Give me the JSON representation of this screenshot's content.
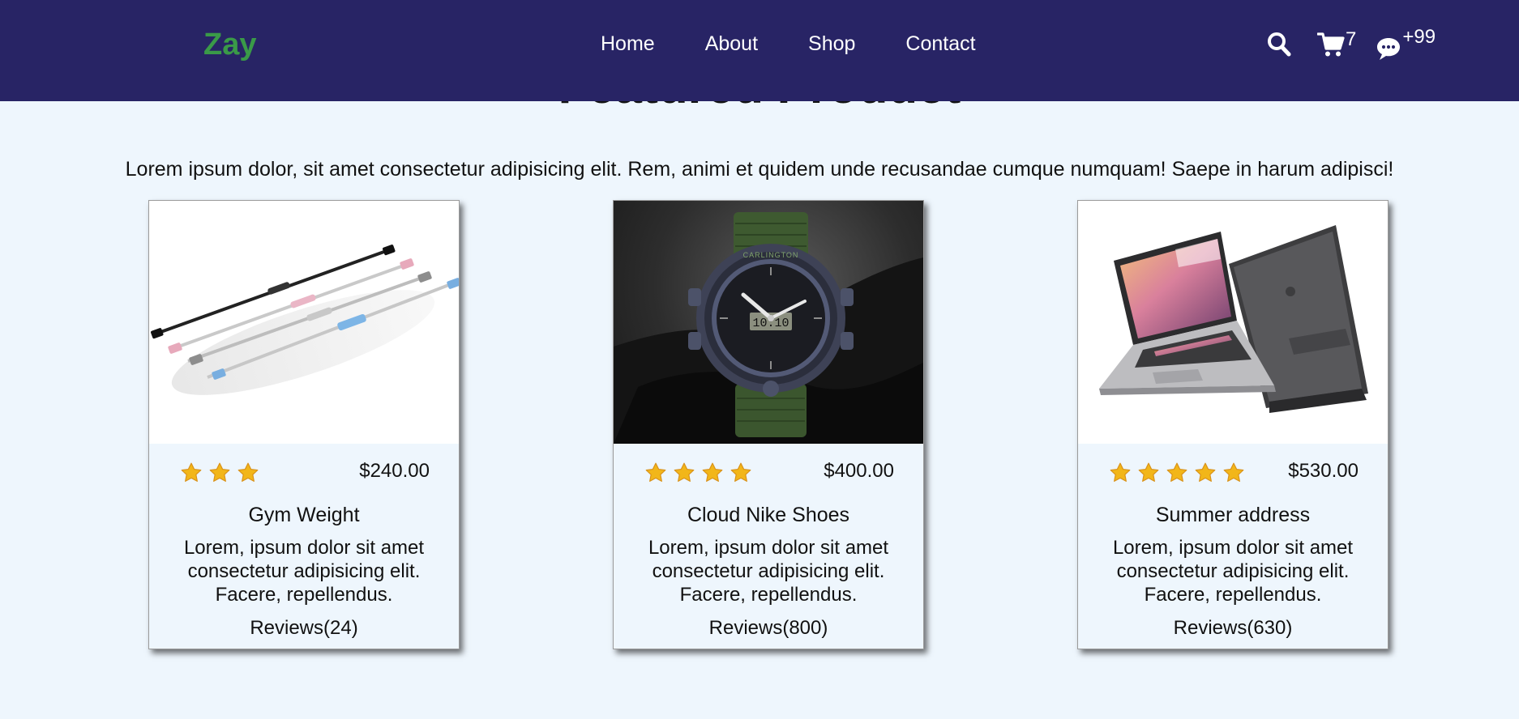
{
  "header": {
    "brand": "Zay",
    "nav": [
      "Home",
      "About",
      "Shop",
      "Contact"
    ],
    "icons": {
      "search": "search-icon",
      "cart": "cart-icon",
      "messages": "chat-icon"
    },
    "cart_count": "7",
    "message_count": "+99",
    "colors": {
      "background": "#282465",
      "brand": "#3a9a48"
    }
  },
  "section": {
    "title": "Featured Product",
    "description": "Lorem ipsum dolor, sit amet consectetur adipisicing elit. Rem, animi et quidem unde recusandae cumque numquam! Saepe in harum adipisci!"
  },
  "products": [
    {
      "name": "Gym Weight",
      "price": "$240.00",
      "rating": 3,
      "description": "Lorem, ipsum dolor sit amet consectetur adipisicing elit. Facere, repellendus.",
      "reviews": "Reviews(24)",
      "image": "gym-weight-bars"
    },
    {
      "name": "Cloud Nike Shoes",
      "price": "$400.00",
      "rating": 4,
      "description": "Lorem, ipsum dolor sit amet consectetur adipisicing elit. Facere, repellendus.",
      "reviews": "Reviews(800)",
      "image": "sport-watch",
      "watch_brand": "CARLINGTON",
      "watch_time": "10:10"
    },
    {
      "name": "Summer address",
      "price": "$530.00",
      "rating": 5,
      "description": "Lorem, ipsum dolor sit amet consectetur adipisicing elit. Facere, repellendus.",
      "reviews": "Reviews(630)",
      "image": "laptop"
    }
  ]
}
